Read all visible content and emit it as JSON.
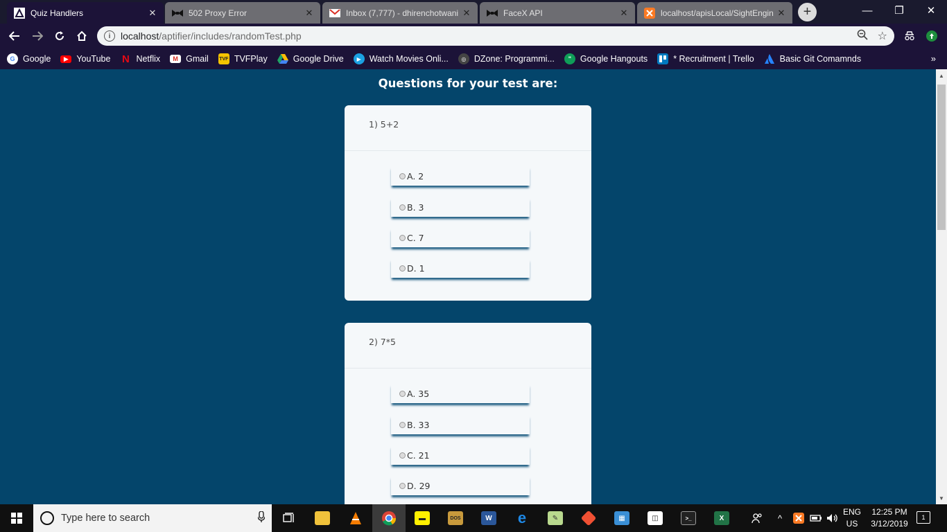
{
  "browser": {
    "tabs": [
      {
        "title": "Quiz Handlers",
        "active": true,
        "icon": "aptifier-logo-icon"
      },
      {
        "title": "502 Proxy Error",
        "active": false,
        "icon": "bowtie-icon"
      },
      {
        "title": "Inbox (7,777) - dhirenchotwani",
        "active": false,
        "icon": "gmail-icon"
      },
      {
        "title": "FaceX API",
        "active": false,
        "icon": "bowtie-icon"
      },
      {
        "title": "localhost/apisLocal/SightEngin",
        "active": false,
        "icon": "xampp-icon"
      }
    ],
    "url_host": "localhost",
    "url_path": "/aptifier/includes/randomTest.php",
    "bookmarks": [
      {
        "label": "Google",
        "icon": "google-icon",
        "color": "#ffffff"
      },
      {
        "label": "YouTube",
        "icon": "youtube-icon",
        "color": "#ff0000"
      },
      {
        "label": "Netflix",
        "icon": "netflix-icon",
        "color": "#e50914"
      },
      {
        "label": "Gmail",
        "icon": "gmail-icon",
        "color": "#ffffff"
      },
      {
        "label": "TVFPlay",
        "icon": "tvfplay-icon",
        "color": "#f5c400"
      },
      {
        "label": "Google Drive",
        "icon": "drive-icon",
        "color": "#1fa463"
      },
      {
        "label": "Watch Movies Onli...",
        "icon": "play-icon",
        "color": "#1ba1e2"
      },
      {
        "label": "DZone: Programmi...",
        "icon": "dzone-icon",
        "color": "#555555"
      },
      {
        "label": "Google Hangouts",
        "icon": "hangouts-icon",
        "color": "#0f9d58"
      },
      {
        "label": "* Recruitment | Trello",
        "icon": "trello-icon",
        "color": "#0079bf"
      },
      {
        "label": "Basic Git Comamnds",
        "icon": "atlassian-icon",
        "color": "#2684ff"
      }
    ],
    "bookmarks_more": "»"
  },
  "page": {
    "heading": "Questions for your test are:",
    "questions": [
      {
        "text": "1) 5+2",
        "options": [
          "A. 2",
          "B. 3",
          "C. 7",
          "D. 1"
        ]
      },
      {
        "text": "2) 7*5",
        "options": [
          "A. 35",
          "B. 33",
          "C. 21",
          "D. 29"
        ]
      }
    ]
  },
  "taskbar": {
    "search_placeholder": "Type here to search",
    "apps": [
      "task-view-icon",
      "file-explorer-icon",
      "vlc-icon",
      "chrome-icon",
      "sticky-notes-icon",
      "dosbox-icon",
      "word-icon",
      "edge-icon",
      "notepad-plus-icon",
      "git-icon",
      "control-panel-icon",
      "sandbox-icon",
      "cmd-icon",
      "excel-icon"
    ],
    "lang_top": "ENG",
    "lang_bottom": "US",
    "time": "12:25 PM",
    "date": "3/12/2019",
    "notif_count": "1"
  }
}
